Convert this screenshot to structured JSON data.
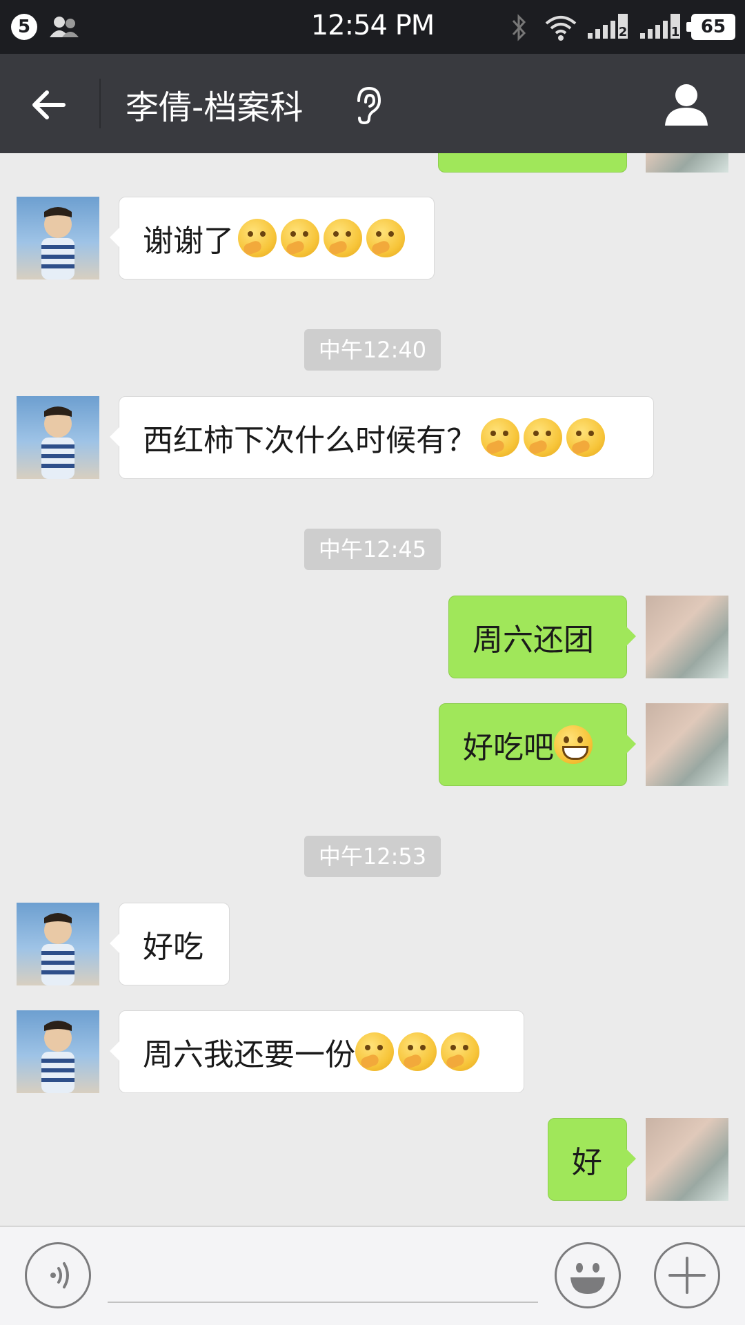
{
  "status_bar": {
    "notification_count": "5",
    "time": "12:54 PM",
    "battery": "65",
    "sim1_label": "2",
    "sim2_label": "1"
  },
  "header": {
    "title": "李倩-档案科"
  },
  "messages": [
    {
      "side": "in",
      "text": "谢谢了",
      "emoji": [
        "thinking-face-icon",
        "thinking-face-icon",
        "thinking-face-icon",
        "thinking-face-icon"
      ]
    },
    {
      "side": "time",
      "text": "中午12:40"
    },
    {
      "side": "in",
      "text": "西红柿下次什么时候有？",
      "emoji": [
        "thinking-face-icon",
        "thinking-face-icon",
        "thinking-face-icon"
      ]
    },
    {
      "side": "time",
      "text": "中午12:45"
    },
    {
      "side": "out",
      "text": "周六还团",
      "emoji": []
    },
    {
      "side": "out",
      "text": "好吃吧",
      "emoji": [
        "grinning-face-icon"
      ]
    },
    {
      "side": "time",
      "text": "中午12:53"
    },
    {
      "side": "in",
      "text": "好吃",
      "emoji": []
    },
    {
      "side": "in",
      "text": "周六我还要一份",
      "emoji": [
        "thinking-face-icon",
        "thinking-face-icon",
        "thinking-face-icon"
      ]
    },
    {
      "side": "out",
      "text": "好",
      "emoji": []
    }
  ],
  "colors": {
    "status_bar_bg": "#1c1d21",
    "title_bar_bg": "#393a3f",
    "chat_bg": "#ebebeb",
    "outgoing_bubble": "#a0e75a",
    "incoming_bubble": "#ffffff",
    "timestamp_bg": "#cecece"
  }
}
